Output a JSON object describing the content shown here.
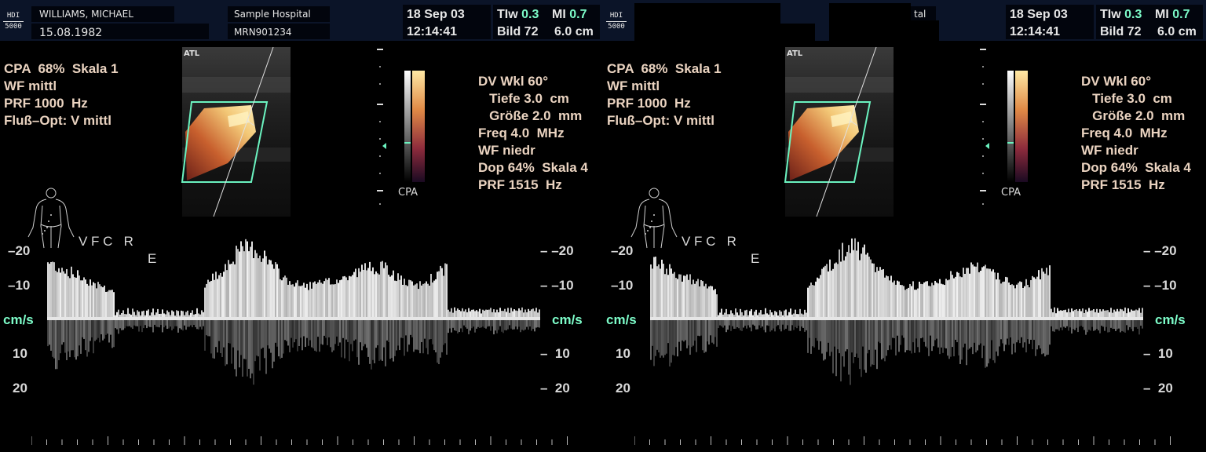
{
  "header": {
    "logo": [
      "HDI",
      "5000"
    ],
    "patient_name": "WILLIAMS, MICHAEL",
    "birth_date": "15.08.1982",
    "hospital": "Sample Hospital",
    "hospital_partial": "tal",
    "mrn": "MRN901234",
    "date": "18 Sep 03",
    "time": "12:14:41",
    "tiw_label": "TIw",
    "tiw_value": "0.3",
    "mi_label": "MI",
    "mi_value": "0.7",
    "bild_label": "Bild",
    "bild_value": "72",
    "depth_cm": "6.0 cm"
  },
  "color_params": {
    "line1": "CPA  68%  Skala 1",
    "line2": "WF mittl",
    "line3": "PRF 1000  Hz",
    "line4": "Fluß–Opt: V mittl"
  },
  "doppler_params": {
    "line1": "DV Wkl 60°",
    "line2": "   Tiefe 3.0  cm",
    "line3": "   Größe 2.0  mm",
    "line4": "Freq 4.0  MHz",
    "line5": "WF niedr",
    "line6": "Dop 64%  Skala 4",
    "line7": "PRF 1515  Hz"
  },
  "image_label": "ATL",
  "colorbar_label": "CPA",
  "vessel_label": {
    "text": "V F C   R",
    "sub": "E"
  },
  "spectrum_axis": {
    "labels": [
      "–20",
      "–10",
      "cm/s",
      "10",
      "20"
    ],
    "unit": "cm/s"
  },
  "colors": {
    "header_bg": "#0b1428",
    "accent_value": "#7dfcc9",
    "param_text": "#ead3c0",
    "roi_box": "#6bf3c0"
  }
}
